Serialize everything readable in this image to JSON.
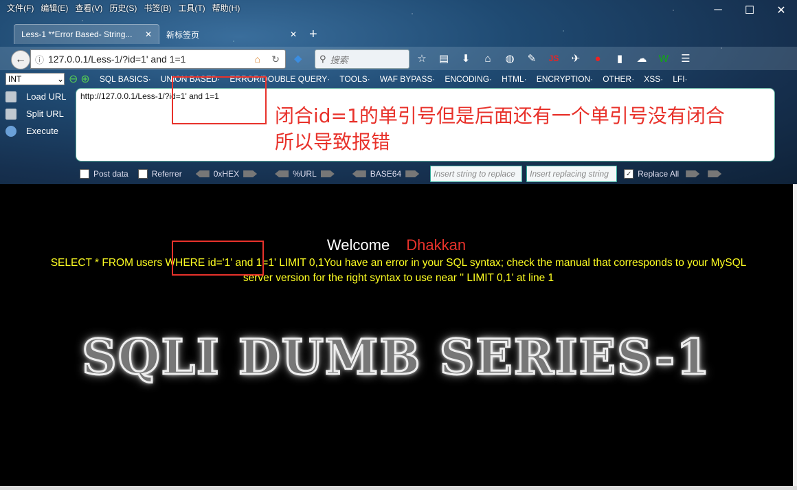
{
  "menubar": [
    "文件(F)",
    "编辑(E)",
    "查看(V)",
    "历史(S)",
    "书签(B)",
    "工具(T)",
    "帮助(H)"
  ],
  "window_controls": {
    "minimize": "─",
    "maximize": "☐",
    "close": "✕"
  },
  "tabs": [
    {
      "label": "Less-1 **Error Based- String...",
      "close": "✕"
    },
    {
      "label": "新标签页",
      "close": "✕"
    }
  ],
  "newtab": "+",
  "url": "127.0.0.1/Less-1/?id=1'  and 1=1",
  "search_placeholder": "搜索",
  "hackbar": {
    "select_value": "INT",
    "menu": [
      "SQL BASICS·",
      "UNION BASED·",
      "ERROR/DOUBLE QUERY·",
      "TOOLS·",
      "WAF BYPASS·",
      "ENCODING·",
      "HTML·",
      "ENCRYPTION·",
      "OTHER·",
      "XSS·",
      "LFI·"
    ],
    "buttons": [
      "Load URL",
      "Split URL",
      "Execute"
    ],
    "textarea": "http://127.0.0.1/Less-1/?id=1'  and 1=1",
    "options": {
      "post": "Post data",
      "referrer": "Referrer",
      "hex": "0xHEX",
      "url": "%URL",
      "base64": "BASE64",
      "insert_placeholder": "Insert string to replace",
      "replacing_placeholder": "Insert replacing string",
      "replace_all": "Replace All"
    }
  },
  "annotation": {
    "line1": "闭合id=1的单引号但是后面还有一个单引号没有闭合",
    "line2": "所以导致报错"
  },
  "page": {
    "welcome": "Welcome",
    "name": "Dhakkan",
    "sql_line1": "SELECT * FROM users WHERE id='1' and 1=1' LIMIT 0,1You have an error in your SQL syntax; check the manual that corresponds to your MySQL",
    "sql_line2": "server version for the right syntax to use near '' LIMIT 0,1' at line 1",
    "banner": "SQLI DUMB SERIES-1"
  },
  "colors": {
    "accent_red": "#e8322b",
    "sql_yellow": "#ffff22"
  }
}
